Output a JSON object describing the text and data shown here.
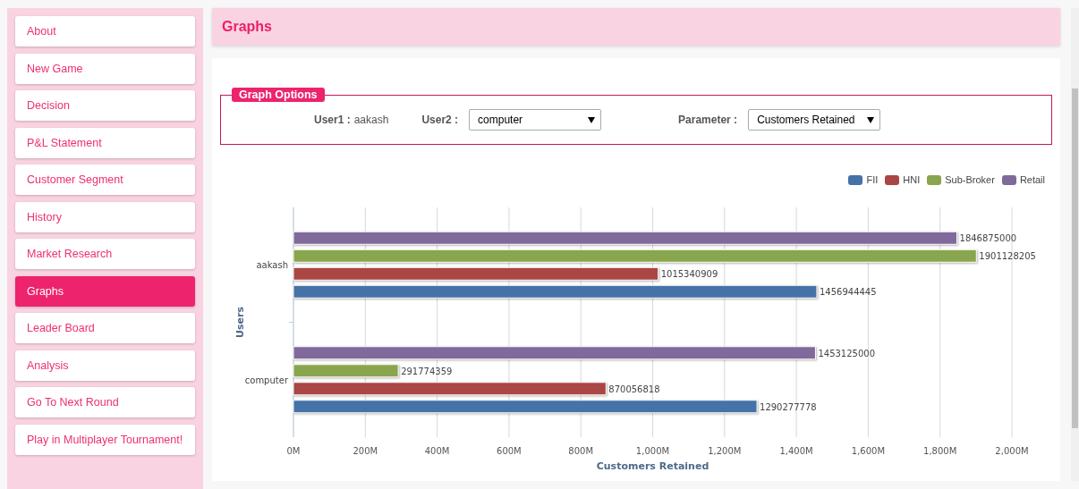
{
  "sidebar": {
    "items": [
      {
        "label": "About",
        "selected": false
      },
      {
        "label": "New Game",
        "selected": false
      },
      {
        "label": "Decision",
        "selected": false
      },
      {
        "label": "P&L Statement",
        "selected": false
      },
      {
        "label": "Customer Segment",
        "selected": false
      },
      {
        "label": "History",
        "selected": false
      },
      {
        "label": "Market Research",
        "selected": false
      },
      {
        "label": "Graphs",
        "selected": true
      },
      {
        "label": "Leader Board",
        "selected": false
      },
      {
        "label": "Analysis",
        "selected": false
      },
      {
        "label": "Go To Next Round",
        "selected": false
      },
      {
        "label": "Play in Multiplayer Tournament!",
        "selected": false
      }
    ]
  },
  "header": {
    "title": "Graphs"
  },
  "graph_options": {
    "legend": "Graph Options",
    "user1_label": "User1 :",
    "user1_value": "aakash",
    "user2_label": "User2 :",
    "user2_value": "computer",
    "parameter_label": "Parameter :",
    "parameter_value": "Customers Retained"
  },
  "chart_data": {
    "type": "bar",
    "orientation": "horizontal",
    "xlabel": "Customers Retained",
    "ylabel": "Users",
    "categories": [
      "aakash",
      "computer"
    ],
    "series": [
      {
        "name": "FII",
        "color": "#4572a7",
        "values": [
          1456944445,
          1290277778
        ]
      },
      {
        "name": "HNI",
        "color": "#aa4643",
        "values": [
          1015340909,
          870056818
        ]
      },
      {
        "name": "Sub-Broker",
        "color": "#89a54e",
        "values": [
          1901128205,
          291774359
        ]
      },
      {
        "name": "Retail",
        "color": "#80699b",
        "values": [
          1846875000,
          1453125000
        ]
      }
    ],
    "xlim": [
      0,
      2000000000
    ],
    "xticks": [
      {
        "value": 0,
        "label": "0M"
      },
      {
        "value": 200000000,
        "label": "200M"
      },
      {
        "value": 400000000,
        "label": "400M"
      },
      {
        "value": 600000000,
        "label": "600M"
      },
      {
        "value": 800000000,
        "label": "800M"
      },
      {
        "value": 1000000000,
        "label": "1,000M"
      },
      {
        "value": 1200000000,
        "label": "1,200M"
      },
      {
        "value": 1400000000,
        "label": "1,400M"
      },
      {
        "value": 1600000000,
        "label": "1,600M"
      },
      {
        "value": 1800000000,
        "label": "1,800M"
      },
      {
        "value": 2000000000,
        "label": "2,000M"
      }
    ],
    "data_labels": true,
    "grid": true
  }
}
